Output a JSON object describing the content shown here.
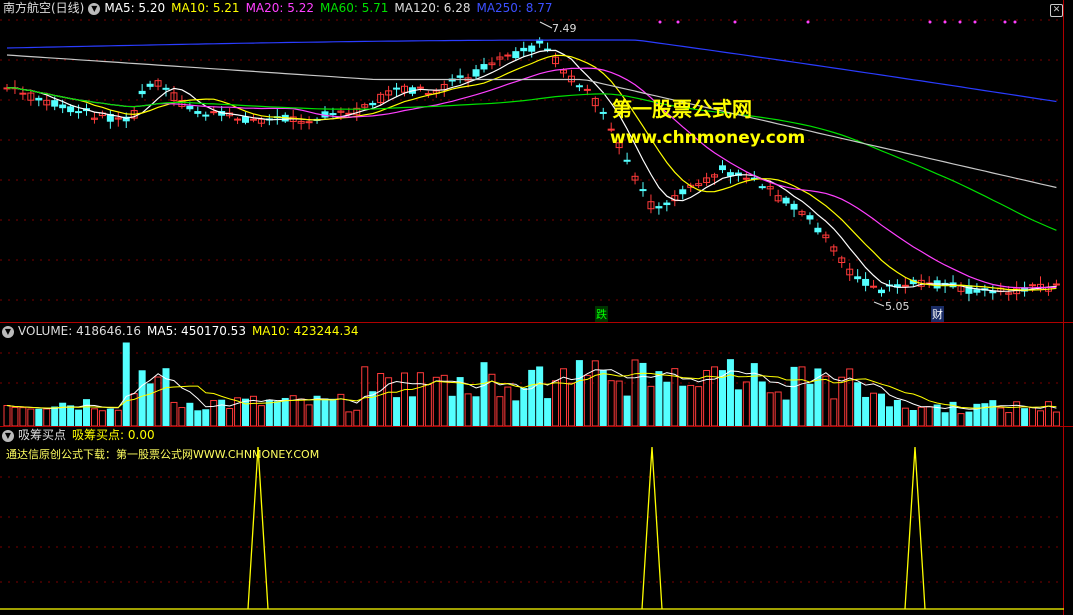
{
  "price_header": {
    "stock_name": "南方航空(日线)",
    "ma5": "MA5: 5.20",
    "ma10": "MA10: 5.21",
    "ma20": "MA20: 5.22",
    "ma60": "MA60: 5.71",
    "ma120": "MA120: 6.28",
    "ma250": "MA250: 8.77"
  },
  "price_markers": {
    "high_label": "7.49",
    "low_label": "5.05",
    "event_die": "跌",
    "event_cai": "财"
  },
  "watermark": {
    "line1": "第一股票公式网",
    "line2": "www.chnmoney.com"
  },
  "volume_header": {
    "volume": "VOLUME: 418646.16",
    "ma5": "MA5: 450170.53",
    "ma10": "MA10: 423244.34"
  },
  "indicator_header": {
    "name": "吸筹买点",
    "value": "吸筹买点: 0.00",
    "note": "通达信原创公式下载：第一股票公式网WWW.CHNMONEY.COM"
  },
  "colors": {
    "up": "#ff3a3a",
    "down": "#54ffff",
    "ma5": "#ffffff",
    "ma10": "#ffff00",
    "ma20": "#ff40ff",
    "ma60": "#00e000",
    "ma120": "#c8c8c8",
    "ma250": "#2a3cff",
    "signal": "#ffff00"
  },
  "chart_data": {
    "type": "candlestick",
    "price_range": [
      4.9,
      7.6
    ],
    "signal_peaks_at_bar": [
      20,
      83,
      120
    ]
  }
}
